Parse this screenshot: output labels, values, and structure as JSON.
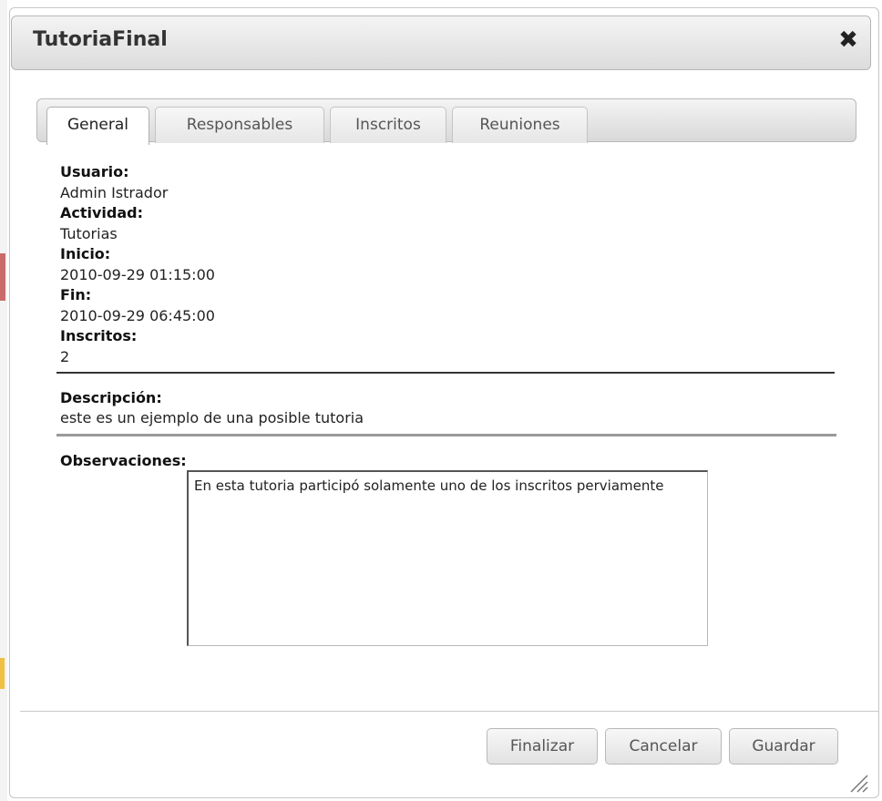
{
  "dialog": {
    "title": "TutoriaFinal",
    "close_icon": "close-icon"
  },
  "tabs": [
    {
      "label": "General",
      "active": true
    },
    {
      "label": "Responsables",
      "active": false
    },
    {
      "label": "Inscritos",
      "active": false
    },
    {
      "label": "Reuniones",
      "active": false
    }
  ],
  "fields": {
    "usuario_label": "Usuario:",
    "usuario_value": "Admin Istrador",
    "actividad_label": "Actividad:",
    "actividad_value": "Tutorias",
    "inicio_label": "Inicio:",
    "inicio_value": "2010-09-29 01:15:00",
    "fin_label": "Fin:",
    "fin_value": "2010-09-29 06:45:00",
    "inscritos_label": "Inscritos:",
    "inscritos_value": "2",
    "descripcion_label": "Descripción:",
    "descripcion_value": "este es un ejemplo de una posible tutoria",
    "observaciones_label": "Observaciones:",
    "observaciones_value": "En esta tutoria participó solamente uno de los inscritos perviamente"
  },
  "buttons": {
    "finalizar": "Finalizar",
    "cancelar": "Cancelar",
    "guardar": "Guardar"
  },
  "icons": {
    "resize": "resize-grip-icon"
  }
}
